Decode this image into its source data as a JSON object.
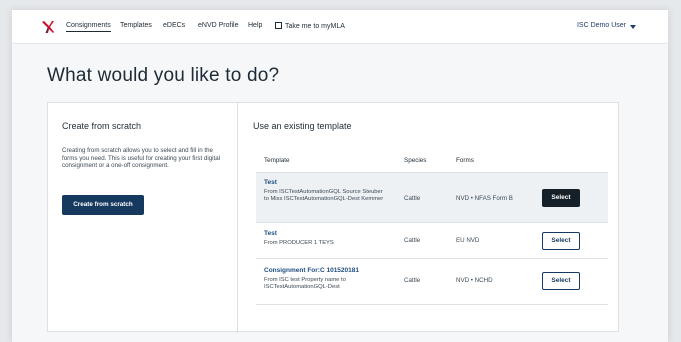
{
  "nav": {
    "items": [
      "Consignments",
      "Templates",
      "eDECs",
      "eNVD Profile",
      "Help"
    ],
    "external_link": "Take me to myMLA",
    "user": "ISC Demo User"
  },
  "page": {
    "heading": "What would you like to do?"
  },
  "scratch": {
    "title": "Create from scratch",
    "description": "Creating from scratch allows you to select and fill in the forms you need. This is useful for creating your first digital consignment or a one-off consignment.",
    "button": "Create from scratch"
  },
  "templates": {
    "title": "Use an existing template",
    "columns": [
      "Template",
      "Species",
      "Forms"
    ],
    "rows": [
      {
        "name": "Test",
        "description": "From ISCTestAutomationGQL Source Steuber to Miss ISCTestAutomationGQL-Dest Kemmer",
        "species": "Cattle",
        "forms": "NVD • NFAS Form B",
        "action": "Select"
      },
      {
        "name": "Test",
        "description": "From PRODUCER 1 TEYS",
        "species": "Cattle",
        "forms": "EU NVD",
        "action": "Select"
      },
      {
        "name": "Consignment For:C 101520181",
        "description": "From ISC test Property name to ISCTestAutomationGQL-Dest",
        "species": "Cattle",
        "forms": "NVD • NCHD",
        "action": "Select"
      }
    ]
  },
  "colors": {
    "primary": "#163a5f",
    "link": "#1d4d80",
    "logo_red": "#c8102e"
  },
  "icons": {
    "logo": "mla-logo-icon",
    "external": "external-link-icon",
    "dropdown": "chevron-down-icon"
  }
}
